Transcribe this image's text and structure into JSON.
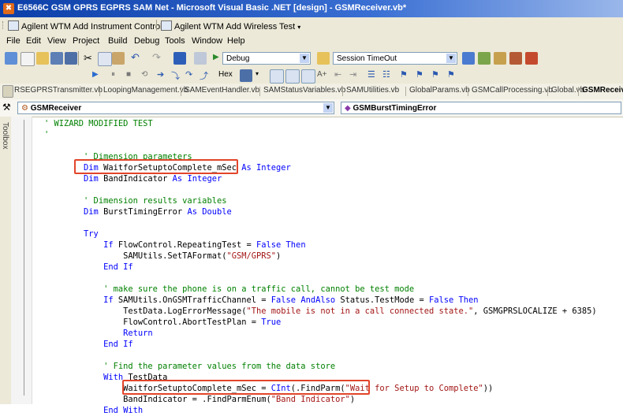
{
  "window": {
    "title": "E6566C GSM GPRS EGPRS SAM Net - Microsoft Visual Basic .NET [design] - GSMReceiver.vb*"
  },
  "addin_toolbar": {
    "items": [
      "Agilent WTM Add Instrument Control",
      "Agilent WTM Add Wireless Test"
    ]
  },
  "menu": {
    "items": [
      "File",
      "Edit",
      "View",
      "Project",
      "Build",
      "Debug",
      "Tools",
      "Window",
      "Help"
    ]
  },
  "toolbar": {
    "config": "Debug",
    "search": "Session TimeOut",
    "hex_label": "Hex"
  },
  "file_tabs": [
    "RSEGPRSTransmitter.vb",
    "LoopingManagement.vb",
    "SAMEventHandler.vb",
    "SAMStatusVariables.vb",
    "SAMUtilities.vb",
    "GlobalParams.vb",
    "GSMCallProcessing.vb",
    "Global.vb",
    "GSMReceiver.vb"
  ],
  "active_tab": "GSMReceiver.vb",
  "nav": {
    "class_name": "GSMReceiver",
    "method_name": "GSMBurstTimingError"
  },
  "sidebar": {
    "toolbox_label": "Toolbox"
  },
  "code": {
    "lines": [
      [
        [
          "cm",
          "' WIZARD MODIFIED TEST"
        ]
      ],
      [
        [
          "cm",
          "'"
        ]
      ],
      [],
      [
        [
          "cm",
          "        ' Dimension parameters"
        ]
      ],
      [
        [
          "kw",
          "        Dim "
        ],
        [
          "t",
          "WaitforSetuptoComplete_mSec "
        ],
        [
          "kw",
          "As Integer"
        ]
      ],
      [
        [
          "kw",
          "        Dim "
        ],
        [
          "t",
          "BandIndicator "
        ],
        [
          "kw",
          "As Integer"
        ]
      ],
      [],
      [
        [
          "cm",
          "        ' Dimension results variables"
        ]
      ],
      [
        [
          "kw",
          "        Dim "
        ],
        [
          "t",
          "BurstTimingError "
        ],
        [
          "kw",
          "As Double"
        ]
      ],
      [],
      [
        [
          "kw",
          "        Try"
        ]
      ],
      [
        [
          "kw",
          "            If "
        ],
        [
          "t",
          "FlowControl.RepeatingTest = "
        ],
        [
          "kw",
          "False Then"
        ]
      ],
      [
        [
          "t",
          "                SAMUtils.SetTAFormat("
        ],
        [
          "st",
          "\"GSM/GPRS\""
        ],
        [
          "t",
          ")"
        ]
      ],
      [
        [
          "kw",
          "            End If"
        ]
      ],
      [],
      [
        [
          "cm",
          "            ' make sure the phone is on a traffic call, cannot be test mode"
        ]
      ],
      [
        [
          "kw",
          "            If "
        ],
        [
          "t",
          "SAMUtils.OnGSMTrafficChannel = "
        ],
        [
          "kw",
          "False AndAlso "
        ],
        [
          "t",
          "Status.TestMode = "
        ],
        [
          "kw",
          "False Then"
        ]
      ],
      [
        [
          "t",
          "                TestData.LogErrorMessage("
        ],
        [
          "st",
          "\"The mobile is not in a call connected state.\""
        ],
        [
          "t",
          ", GSMGPRSLOCALIZE + 6385)"
        ]
      ],
      [
        [
          "t",
          "                FlowControl.AbortTestPlan = "
        ],
        [
          "kw",
          "True"
        ]
      ],
      [
        [
          "kw",
          "                Return"
        ]
      ],
      [
        [
          "kw",
          "            End If"
        ]
      ],
      [],
      [
        [
          "cm",
          "            ' Find the parameter values from the data store"
        ]
      ],
      [
        [
          "kw",
          "            With "
        ],
        [
          "t",
          "TestData"
        ]
      ],
      [
        [
          "t",
          "                WaitforSetuptoComplete_mSec = "
        ],
        [
          "kw",
          "CInt"
        ],
        [
          "t",
          "(.FindParm("
        ],
        [
          "st",
          "\"Wait for Setup to Complete\""
        ],
        [
          "t",
          "))"
        ]
      ],
      [
        [
          "t",
          "                BandIndicator = .FindParmEnum("
        ],
        [
          "st",
          "\"Band Indicator\""
        ],
        [
          "t",
          ")"
        ]
      ],
      [
        [
          "kw",
          "            End With"
        ]
      ]
    ]
  },
  "colors": {
    "keyword": "#0000ff",
    "comment": "#008000",
    "string": "#a31515",
    "highlight": "#e2452a"
  }
}
